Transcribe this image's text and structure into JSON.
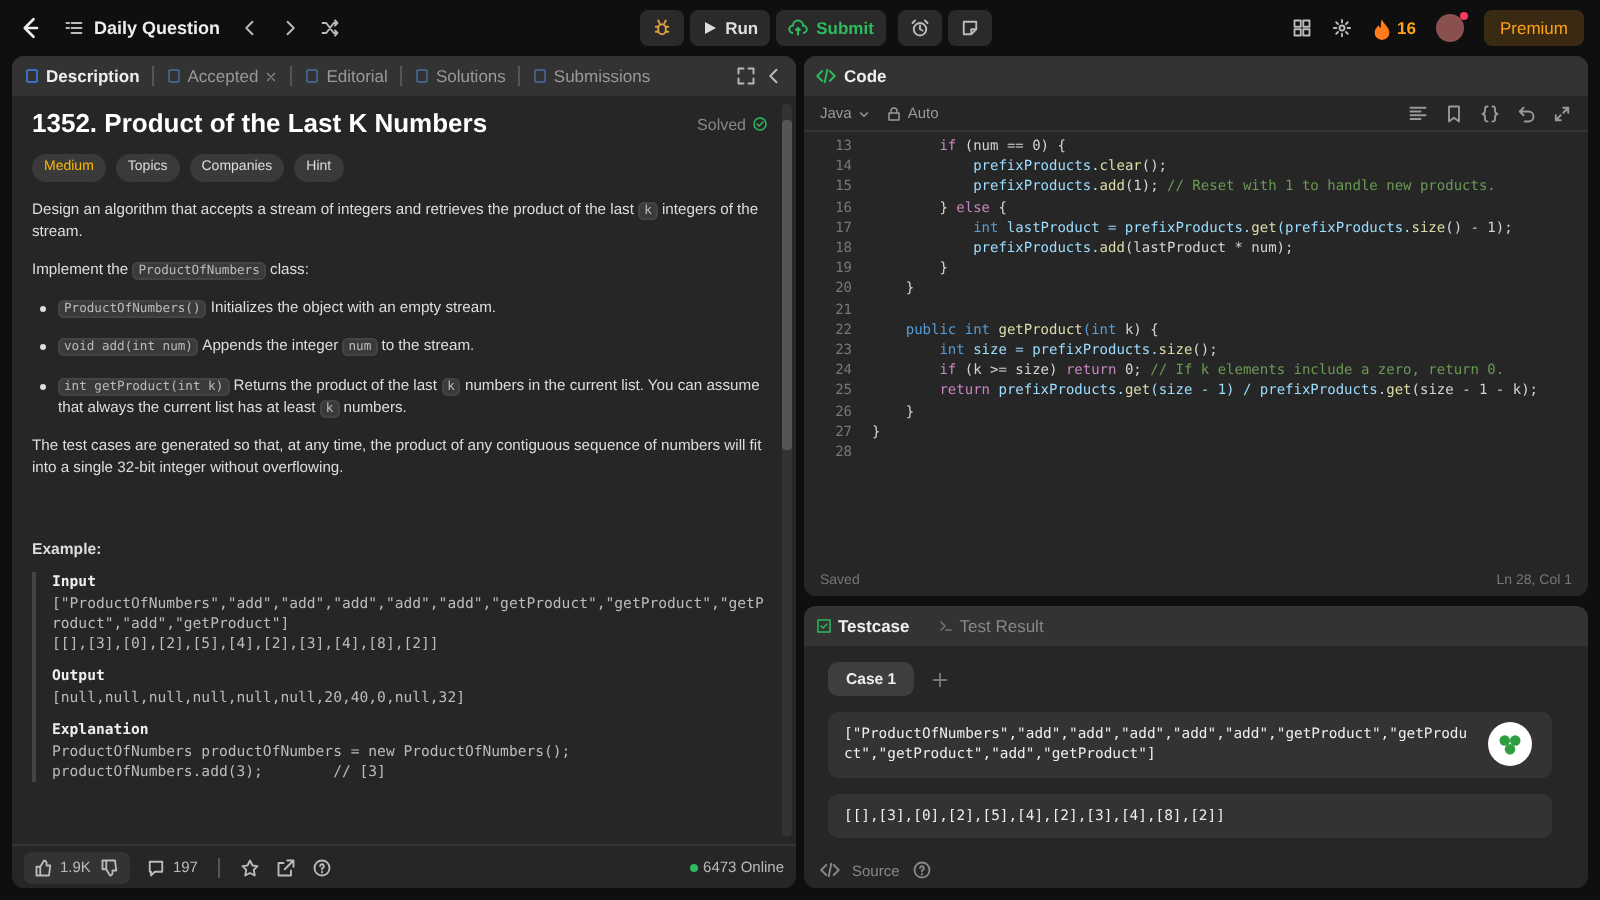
{
  "topbar": {
    "title": "Daily Question",
    "run": "Run",
    "submit": "Submit",
    "streak": "16",
    "premium": "Premium"
  },
  "description": {
    "tabs": [
      {
        "label": "Description",
        "selected": true,
        "closable": false
      },
      {
        "label": "Accepted",
        "selected": false,
        "closable": true
      },
      {
        "label": "Editorial",
        "selected": false,
        "closable": false
      },
      {
        "label": "Solutions",
        "selected": false,
        "closable": false
      },
      {
        "label": "Submissions",
        "selected": false,
        "closable": false
      }
    ],
    "title": "1352. Product of the Last K Numbers",
    "status": "Solved",
    "difficulty": "Medium",
    "chips": [
      "Topics",
      "Companies",
      "Hint"
    ],
    "paragraphs": [
      {
        "kind": "p",
        "parts": [
          {
            "text": "Design an algorithm that accepts a stream of integers and retrieves the product of the last ",
            "kind": "text"
          },
          {
            "text": "k",
            "kind": "code"
          },
          {
            "text": " integers of the stream.",
            "kind": "text"
          }
        ]
      },
      {
        "kind": "p",
        "parts": [
          {
            "text": "Implement the ",
            "kind": "text"
          },
          {
            "text": "ProductOfNumbers",
            "kind": "code"
          },
          {
            "text": " class:",
            "kind": "text"
          }
        ]
      },
      {
        "kind": "bullet",
        "parts": [
          {
            "text": "ProductOfNumbers()",
            "kind": "code"
          },
          {
            "text": " Initializes the object with an empty stream.",
            "kind": "text"
          }
        ]
      },
      {
        "kind": "bullet",
        "parts": [
          {
            "text": "void add(int num)",
            "kind": "code"
          },
          {
            "text": " Appends the integer ",
            "kind": "text"
          },
          {
            "text": "num",
            "kind": "code"
          },
          {
            "text": " to the stream.",
            "kind": "text"
          }
        ]
      },
      {
        "kind": "bullet",
        "parts": [
          {
            "text": "int getProduct(int k)",
            "kind": "code"
          },
          {
            "text": " Returns the product of the last ",
            "kind": "text"
          },
          {
            "text": "k",
            "kind": "code"
          },
          {
            "text": " numbers in the current list. You can assume that always the current list has at least ",
            "kind": "text"
          },
          {
            "text": "k",
            "kind": "code"
          },
          {
            "text": " numbers.",
            "kind": "text"
          }
        ]
      },
      {
        "kind": "p",
        "parts": [
          {
            "text": "The test cases are generated so that, at any time, the product of any contiguous sequence of numbers will fit into a single 32-bit integer without overflowing.",
            "kind": "text"
          }
        ]
      }
    ],
    "example": {
      "heading": "Example:",
      "sections": [
        {
          "label": "Input",
          "lines": [
            "[\"ProductOfNumbers\",\"add\",\"add\",\"add\",\"add\",\"add\",\"getProduct\",\"getProduct\",\"getProduct\",\"add\",\"getProduct\"]",
            "[[],[3],[0],[2],[5],[4],[2],[3],[4],[8],[2]]"
          ]
        },
        {
          "label": "Output",
          "lines": [
            "[null,null,null,null,null,null,20,40,0,null,32]"
          ]
        },
        {
          "label": "Explanation",
          "lines": [
            "ProductOfNumbers productOfNumbers = new ProductOfNumbers();",
            "productOfNumbers.add(3);        // [3]"
          ]
        }
      ]
    },
    "footer": {
      "likes": "1.9K",
      "comments": "197",
      "online": "6473 Online"
    }
  },
  "code": {
    "title": "Code",
    "language": "Java",
    "mode": "Auto",
    "lines": [
      {
        "number": "13",
        "tokens": [
          {
            "kind": "keyword",
            "text": "        if"
          },
          {
            "kind": "plain",
            "text": " (num == 0) {"
          }
        ]
      },
      {
        "number": "14",
        "tokens": [
          {
            "kind": "variable",
            "text": "            prefixProducts."
          },
          {
            "kind": "function",
            "text": "clear"
          },
          {
            "kind": "plain",
            "text": "();"
          }
        ]
      },
      {
        "number": "15",
        "tokens": [
          {
            "kind": "variable",
            "text": "            prefixProducts."
          },
          {
            "kind": "function",
            "text": "add"
          },
          {
            "kind": "plain",
            "text": "(1); "
          },
          {
            "kind": "comment",
            "text": "// Reset with 1 to handle new products."
          }
        ]
      },
      {
        "number": "16",
        "tokens": [
          {
            "kind": "plain",
            "text": "        } "
          },
          {
            "kind": "keyword",
            "text": "else"
          },
          {
            "kind": "plain",
            "text": " {"
          }
        ]
      },
      {
        "number": "17",
        "tokens": [
          {
            "kind": "type",
            "text": "            int"
          },
          {
            "kind": "variable",
            "text": " lastProduct = prefixProducts."
          },
          {
            "kind": "function",
            "text": "get"
          },
          {
            "kind": "variable",
            "text": "(prefixProducts."
          },
          {
            "kind": "function",
            "text": "size"
          },
          {
            "kind": "plain",
            "text": "() - 1);"
          }
        ]
      },
      {
        "number": "18",
        "tokens": [
          {
            "kind": "variable",
            "text": "            prefixProducts."
          },
          {
            "kind": "function",
            "text": "add"
          },
          {
            "kind": "plain",
            "text": "(lastProduct * num);"
          }
        ]
      },
      {
        "number": "19",
        "tokens": [
          {
            "kind": "plain",
            "text": "        }"
          }
        ]
      },
      {
        "number": "20",
        "tokens": [
          {
            "kind": "plain",
            "text": "    }"
          }
        ]
      },
      {
        "number": "21"
      },
      {
        "number": "22",
        "tokens": [
          {
            "kind": "type",
            "text": "    public int"
          },
          {
            "kind": "function",
            "text": " getProduct"
          },
          {
            "kind": "type",
            "text": "(int"
          },
          {
            "kind": "plain",
            "text": " k) {"
          }
        ]
      },
      {
        "number": "23",
        "tokens": [
          {
            "kind": "type",
            "text": "        int"
          },
          {
            "kind": "variable",
            "text": " size = prefixProducts."
          },
          {
            "kind": "function",
            "text": "size"
          },
          {
            "kind": "plain",
            "text": "();"
          }
        ]
      },
      {
        "number": "24",
        "tokens": [
          {
            "kind": "keyword",
            "text": "        if"
          },
          {
            "kind": "plain",
            "text": " (k >= size) "
          },
          {
            "kind": "keyword",
            "text": "return"
          },
          {
            "kind": "plain",
            "text": " 0; "
          },
          {
            "kind": "comment",
            "text": "// If k elements include a zero, return 0."
          }
        ]
      },
      {
        "number": "25",
        "tokens": [
          {
            "kind": "keyword",
            "text": "        return"
          },
          {
            "kind": "variable",
            "text": " prefixProducts."
          },
          {
            "kind": "function",
            "text": "get"
          },
          {
            "kind": "variable",
            "text": "(size - 1) / prefixProducts."
          },
          {
            "kind": "function",
            "text": "get"
          },
          {
            "kind": "plain",
            "text": "(size - 1 - k);"
          }
        ]
      },
      {
        "number": "26",
        "tokens": [
          {
            "kind": "plain",
            "text": "    }"
          }
        ]
      },
      {
        "number": "27",
        "tokens": [
          {
            "kind": "plain",
            "text": "}"
          }
        ]
      },
      {
        "number": "28"
      }
    ],
    "status": "Saved",
    "cursor": "Ln 28, Col 1"
  },
  "testcase": {
    "tabs": [
      {
        "label": "Testcase",
        "selected": true
      },
      {
        "label": "Test Result",
        "selected": false
      }
    ],
    "cases": [
      {
        "label": "Case 1",
        "selected": true
      }
    ],
    "values": [
      "[\"ProductOfNumbers\",\"add\",\"add\",\"add\",\"add\",\"add\",\"getProduct\",\"getProduct\",\"getProduct\",\"add\",\"getProduct\"]",
      "[[],[3],[0],[2],[5],[4],[2],[3],[4],[8],[2]]"
    ],
    "source": "Source"
  }
}
